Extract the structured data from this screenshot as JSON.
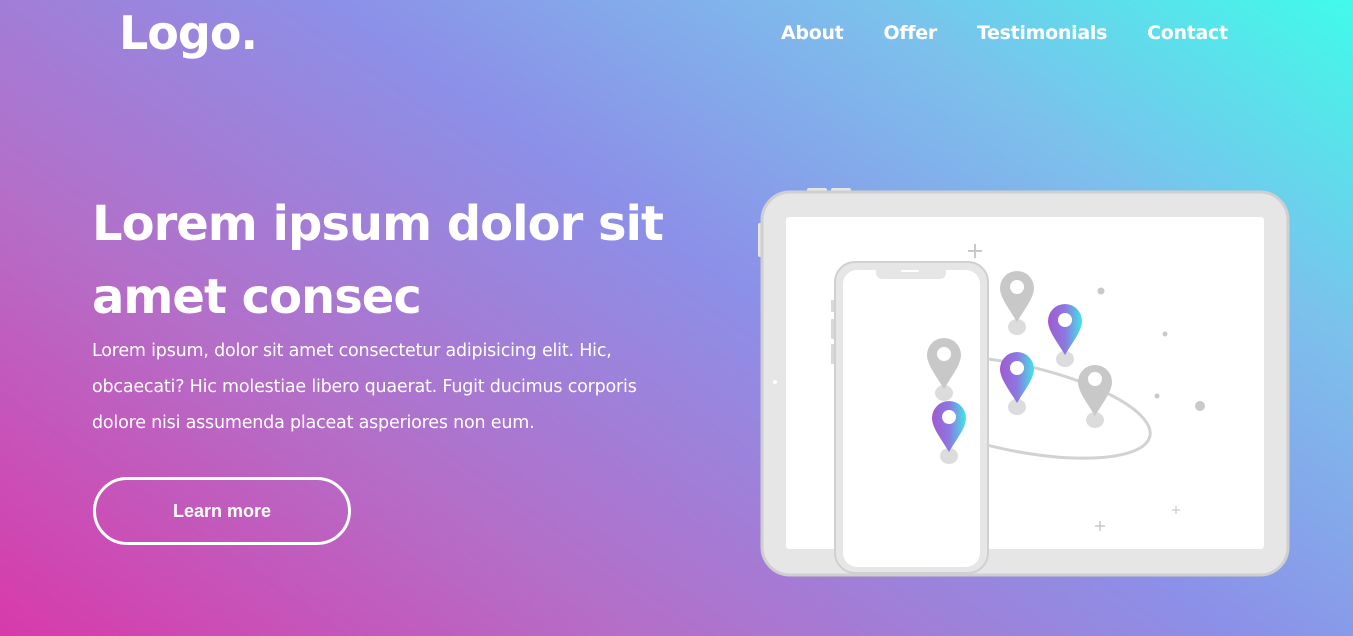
{
  "header": {
    "logo": "Logo.",
    "nav": [
      "About",
      "Offer",
      "Testimonials",
      "Contact"
    ]
  },
  "hero": {
    "title": "Lorem ipsum dolor sit amet consec",
    "text": "Lorem ipsum, dolor sit amet consectetur adipisicing elit. Hic, obcaecati? Hic molestiae libero quaerat. Fugit ducimus corporis dolore nisi assumenda placeat asperiores non eum.",
    "cta_label": "Learn more"
  },
  "colors": {
    "gradient_start": "#d83aaa",
    "gradient_mid": "#8c90e8",
    "gradient_end": "#40fbea",
    "device_frame": "#e6e6e6",
    "pin_gray": "#c8c8c8"
  },
  "illustration": {
    "name": "devices-map-pins-illustration"
  }
}
